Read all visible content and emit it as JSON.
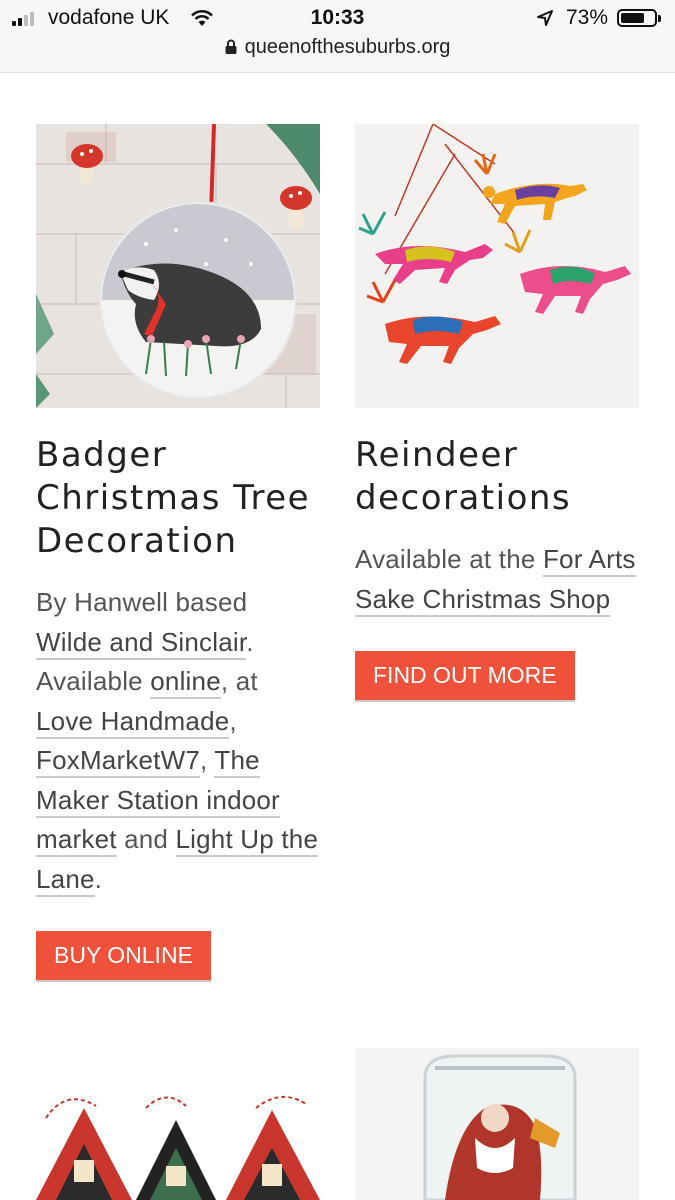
{
  "status": {
    "carrier": "vodafone UK",
    "time": "10:33",
    "battery": "73%",
    "battery_level": 0.73,
    "url": "queenofthesuburbs.org"
  },
  "cards": [
    {
      "title_lines": [
        "Badger",
        "Christmas Tree",
        "Decoration"
      ],
      "desc": {
        "t1": "By Hanwell based ",
        "link1": "Wilde and Sinclair",
        "t2": ". Available ",
        "link2": "online",
        "t3": ", at ",
        "link3": "Love Handmade",
        "t4": ", ",
        "link4": "FoxMarketW7",
        "t5": ", ",
        "link5": "The Maker Station indoor market",
        "t6": " and ",
        "link6": "Light Up the Lane",
        "t7": "."
      },
      "button": "BUY ONLINE"
    },
    {
      "title_lines": [
        "Reindeer",
        "decorations"
      ],
      "desc": {
        "t1": "Available at the ",
        "link1": "For Arts Sake Christmas Shop"
      },
      "button": "FIND OUT MORE"
    }
  ],
  "colors": {
    "button": "#f0513b",
    "link_underline": "#c9c9c9"
  },
  "icons": [
    "signal-icon",
    "wifi-icon",
    "location-arrow-icon",
    "battery-icon",
    "lock-icon"
  ]
}
